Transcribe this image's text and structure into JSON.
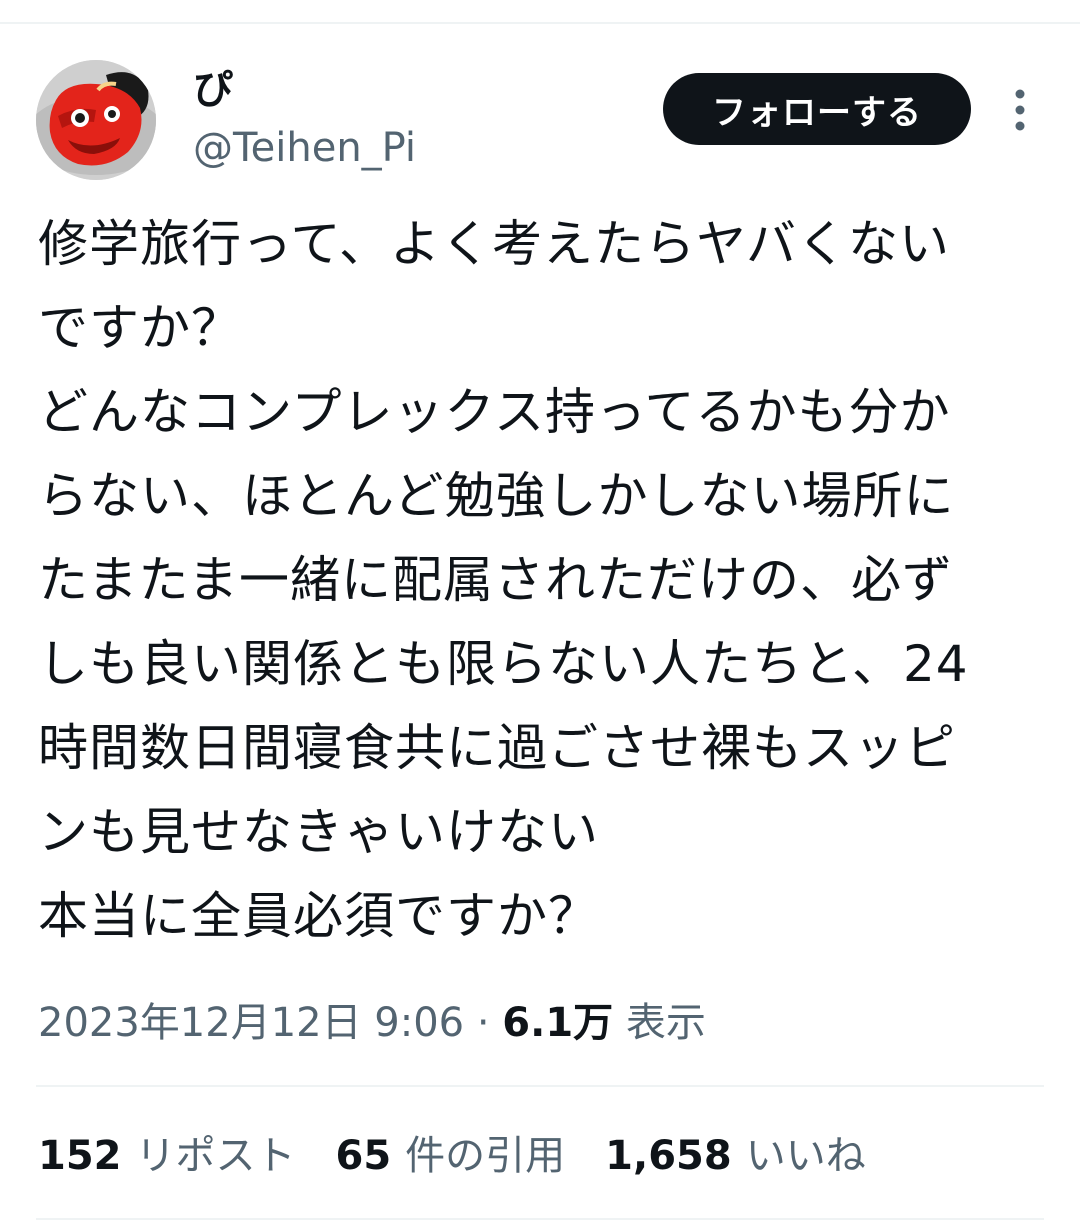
{
  "author": {
    "display_name": "ぴ",
    "handle": "@Teihen_Pi",
    "avatar_icon": "red-tengu-mask-avatar"
  },
  "actions": {
    "follow_label": "フォローする",
    "more_icon": "more-vertical-icon"
  },
  "tweet": {
    "text": "修学旅行って、よく考えたらヤバくない\nですか？\nどんなコンプレックス持ってるかも分か\nらない、ほとんど勉強しかしない場所に\nたまたま一緒に配属されただけの、必ず\nしも良い関係とも限らない人たちと、24\n時間数日間寝食共に過ごさせ裸もスッピ\nンも見せなきゃいけない\n本当に全員必須ですか？"
  },
  "meta": {
    "timestamp": "2023年12月12日 9:06",
    "separator": " · ",
    "views_count": "6.1万",
    "views_label": "表示"
  },
  "stats": [
    {
      "count": "152",
      "label": "リポスト"
    },
    {
      "count": "65",
      "label": "件の引用"
    },
    {
      "count": "1,658",
      "label": "いいね"
    }
  ],
  "colors": {
    "text": "#0f1419",
    "secondary": "#536471",
    "divider": "#eff3f4",
    "button_bg": "#0f1419"
  }
}
